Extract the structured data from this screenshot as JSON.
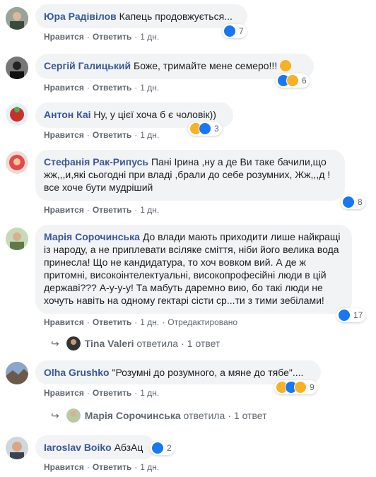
{
  "actions": {
    "like": "Нравится",
    "reply": "Ответить",
    "time": "1 дн.",
    "edited": "Отредактировано",
    "dot": "·"
  },
  "comments": [
    {
      "author": "Юра Радівілов",
      "text": "Капець продовжується...",
      "reactions": {
        "icons": [
          "like-icon"
        ],
        "count": "7"
      }
    },
    {
      "author": "Сергій Галицький",
      "text": "Боже, тримайте мене семеро!!!",
      "reactions": {
        "icons": [
          "like-icon",
          "haha-icon"
        ],
        "count": "6"
      }
    },
    {
      "author": "Антон Каі",
      "text": "Ну, у цієї хоча б є чоловік))",
      "reactions": {
        "icons": [
          "haha-icon",
          "like-icon"
        ],
        "count": "3"
      }
    },
    {
      "author": "Стефанія Рак-Рипусь",
      "text": "Пані Ірина ,ну а де Ви таке бачили,що жж,,,и,які сьогодні при владі ,брали до себе розумних, Жж,,,д !все хоче бути мудріший",
      "reactions": {
        "icons": [
          "like-icon"
        ],
        "count": "8"
      }
    },
    {
      "author": "Марія Сорочинська",
      "text": "До влади мають приходити лише найкращі із народу, а не приплевати всіляке сміття, ніби його велика вода принесла! Що не кандидатура, то хоч вовком вий. А де ж притомні, високоінтелектуальні, високопрофесійні люди в цій державі??? А-у-у-у! Та мабуть даремно вию, бо такі люди не хочуть навіть на одному гектарі сісти ср...ти з тими зебілами!",
      "reactions": {
        "icons": [
          "like-icon"
        ],
        "count": "17"
      }
    },
    {
      "author": "Olha Grushko",
      "text": "\"Розумні до розумного, а мяне до тябе\"....",
      "reactions": {
        "icons": [
          "haha-icon",
          "like-icon",
          "sad-icon"
        ],
        "count": "9"
      }
    },
    {
      "author": "Iaroslav Boiko",
      "text": "АбзАц",
      "reactions": {
        "icons": [
          "like-icon"
        ],
        "count": "2"
      }
    }
  ],
  "replies": [
    {
      "name": "Tina Valeri",
      "verb": "ответила",
      "count": "1 ответ"
    },
    {
      "name": "Марія Сорочинська",
      "verb": "ответила",
      "count": "1 ответ"
    }
  ]
}
